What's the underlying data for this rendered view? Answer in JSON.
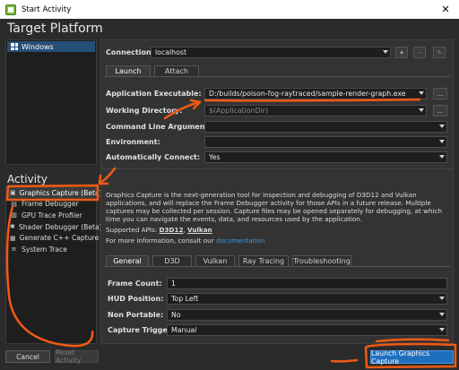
{
  "window": {
    "title": "Start Activity",
    "close_glyph": "✕"
  },
  "target_platform": {
    "heading": "Target Platform",
    "items": [
      {
        "label": "Windows",
        "icon": "windows-logo-icon"
      }
    ]
  },
  "connection": {
    "label": "Connection:",
    "value": "localhost",
    "add_glyph": "+",
    "remove_glyph": "−",
    "edit_glyph": "✎"
  },
  "connection_tabs": [
    {
      "label": "Launch",
      "active": true
    },
    {
      "label": "Attach",
      "active": false
    }
  ],
  "launch": {
    "executable_label": "Application Executable:",
    "executable_value": "D:/builds/poison-fog-raytraced/sample-render-graph.exe",
    "working_dir_label": "Working Directory:",
    "working_dir_value": "$(ApplicationDir)",
    "cmd_args_label": "Command Line Arguments:",
    "cmd_args_value": "",
    "environment_label": "Environment:",
    "environment_value": "",
    "auto_connect_label": "Automatically Connect:",
    "auto_connect_value": "Yes",
    "browse_glyph": "..."
  },
  "activity": {
    "heading": "Activity",
    "items": [
      {
        "label": "Graphics Capture (Beta)",
        "icon": "camera-icon",
        "glyph": "▣",
        "selected": true
      },
      {
        "label": "Frame Debugger",
        "icon": "frame-icon",
        "glyph": "▤",
        "selected": false
      },
      {
        "label": "GPU Trace Profiler",
        "icon": "chart-icon",
        "glyph": "▥",
        "selected": false
      },
      {
        "label": "Shader Debugger (Beta)",
        "icon": "bug-icon",
        "glyph": "✱",
        "selected": false
      },
      {
        "label": "Generate C++ Capture",
        "icon": "code-icon",
        "glyph": "▦",
        "selected": false
      },
      {
        "label": "System Trace",
        "icon": "trace-icon",
        "glyph": "≡",
        "selected": false
      }
    ]
  },
  "description": {
    "para1": "Graphics Capture is the next-generation tool for inspection and debugging of D3D12 and Vulkan applications, and will replace the Frame Debugger activity for those APIs in a future release. Multiple captures may be collected per session. Capture files may be opened separately for debugging, at which time you can navigate the events, data, and resources used by the application.",
    "apis_prefix": "Supported APIs: ",
    "api1": "D3D12",
    "api_sep": ", ",
    "api2": "Vulkan",
    "more_prefix": "For more information, consult our ",
    "more_link": "documentation"
  },
  "settings_tabs": [
    {
      "label": "General",
      "active": true
    },
    {
      "label": "D3D",
      "active": false
    },
    {
      "label": "Vulkan",
      "active": false
    },
    {
      "label": "Ray Tracing",
      "active": false
    },
    {
      "label": "Troubleshooting",
      "active": false
    }
  ],
  "general": {
    "frame_count_label": "Frame Count:",
    "frame_count_value": "1",
    "hud_label": "HUD Position:",
    "hud_value": "Top Left",
    "non_portable_label": "Non Portable:",
    "non_portable_value": "No",
    "trigger_label": "Capture Trigger:",
    "trigger_value": "Manual"
  },
  "footer": {
    "cancel": "Cancel",
    "reset": "Reset Activity",
    "launch": "Launch Graphics Capture"
  },
  "colors": {
    "accent": "#1f6fbf",
    "annotation": "#f05a14",
    "link": "#3c9bdc"
  }
}
